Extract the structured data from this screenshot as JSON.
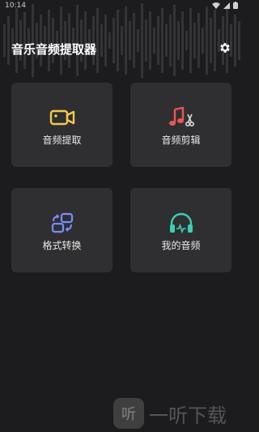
{
  "status_bar": {
    "time": "10:14"
  },
  "app": {
    "title": "音乐音频提取器"
  },
  "cards": [
    {
      "label": "音频提取",
      "icon": "video-camera-icon",
      "color": "#f2c94c"
    },
    {
      "label": "音频剪辑",
      "icon": "music-note-scissors-icon",
      "color": "#eb5757"
    },
    {
      "label": "格式转换",
      "icon": "convert-arrows-icon",
      "color": "#7b8cff"
    },
    {
      "label": "我的音频",
      "icon": "headphones-icon",
      "color": "#3ccfb4"
    }
  ],
  "watermark": {
    "logo": "听",
    "text": "一听下载"
  }
}
